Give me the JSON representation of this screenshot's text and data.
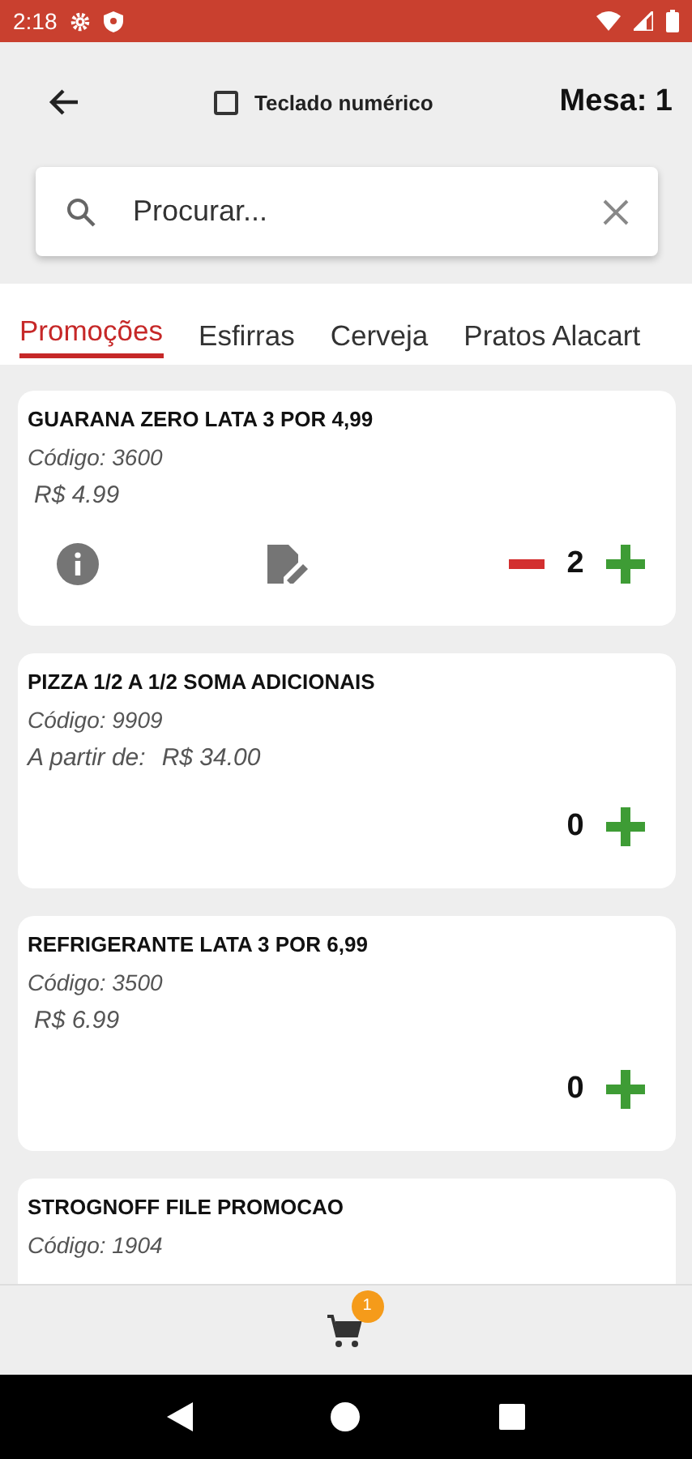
{
  "status_bar": {
    "time": "2:18"
  },
  "header": {
    "numeric_keyboard": {
      "label": "Teclado numérico",
      "checked": false
    },
    "table": "Mesa: 1"
  },
  "search": {
    "placeholder": "Procurar..."
  },
  "tabs": [
    {
      "label": "Promoções",
      "selected": true
    },
    {
      "label": "Esfirras",
      "selected": false
    },
    {
      "label": "Cerveja",
      "selected": false
    },
    {
      "label": "Pratos Alacart",
      "selected": false
    }
  ],
  "products": [
    {
      "name": "GUARANA ZERO LATA 3 POR 4,99",
      "code": "Código: 3600",
      "price": "R$ 4.99",
      "quantity": "2",
      "in_cart": true
    },
    {
      "name": "PIZZA 1/2 A 1/2 SOMA ADICIONAIS",
      "code": "Código: 9909",
      "price_label": "A partir de:",
      "price": "R$ 34.00",
      "quantity": "0",
      "in_cart": false
    },
    {
      "name": "REFRIGERANTE LATA 3 POR 6,99",
      "code": "Código: 3500",
      "price": "R$ 6.99",
      "quantity": "0",
      "in_cart": false
    },
    {
      "name": "STROGNOFF FILE PROMOCAO",
      "code": "Código: 1904"
    }
  ],
  "cart": {
    "badge": "1"
  }
}
